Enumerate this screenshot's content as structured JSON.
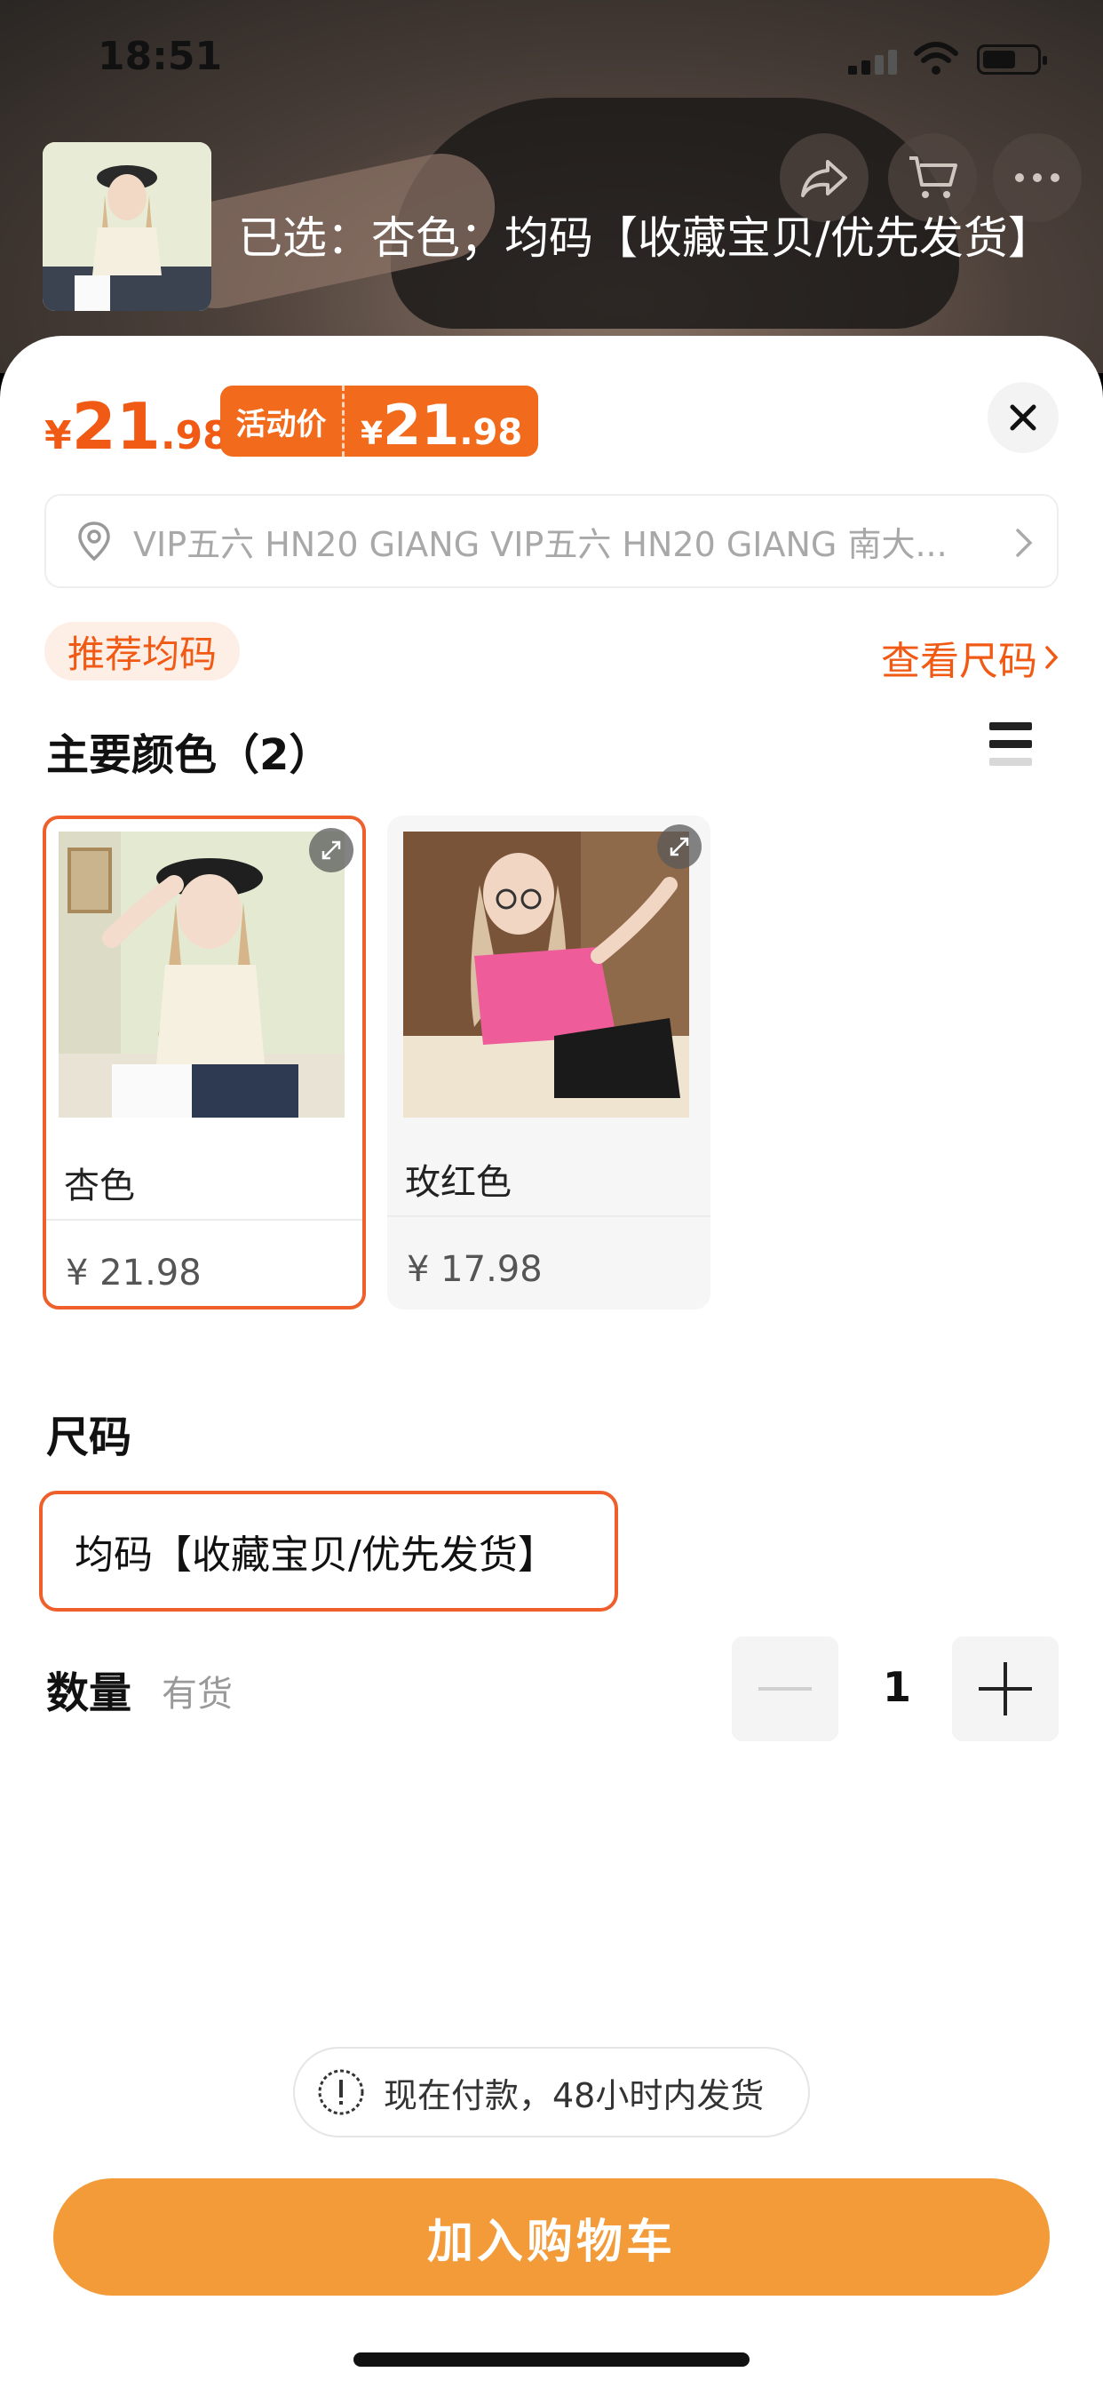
{
  "status_bar": {
    "time": "18:51"
  },
  "header": {
    "selected_text": "已选：杏色；均码【收藏宝贝/优先发货】"
  },
  "price": {
    "currency": "¥",
    "integer": "21",
    "decimal": ".98",
    "promo_tag": "活动价",
    "promo_currency": "¥",
    "promo_integer": "21",
    "promo_decimal": ".98"
  },
  "address": {
    "text": "VIP五六 HN20 GIANG VIP五六 HN20 GIANG 南大..."
  },
  "size_hint": {
    "recommend": "推荐均码",
    "size_chart": "查看尺码"
  },
  "colors": {
    "title": "主要颜色（2）",
    "options": [
      {
        "name": "杏色",
        "price": "¥ 21.98",
        "selected": true
      },
      {
        "name": "玫红色",
        "price": "¥ 17.98",
        "selected": false
      }
    ]
  },
  "size": {
    "title": "尺码",
    "options": [
      "均码【收藏宝贝/优先发货】"
    ]
  },
  "quantity": {
    "label": "数量",
    "stock": "有货",
    "value": "1"
  },
  "notice": {
    "text": "现在付款，48小时内发货"
  },
  "actions": {
    "add_to_cart": "加入购物车"
  },
  "colors_theme": {
    "accent": "#f05a14",
    "button": "#f39a39",
    "selected_border": "#ef5f2c"
  }
}
